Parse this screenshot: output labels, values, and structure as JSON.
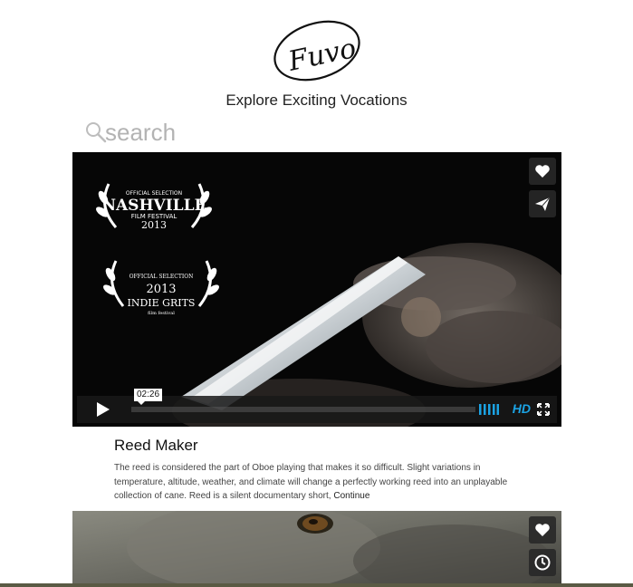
{
  "header": {
    "logo_text": "Fuvo",
    "tagline": "Explore Exciting Vocations"
  },
  "search": {
    "placeholder": "search"
  },
  "videos": [
    {
      "laurels": [
        {
          "line1": "OFFICIAL SELECTION",
          "line2": "NASHVILLE",
          "line3": "FILM FESTIVAL",
          "line4": "2013"
        },
        {
          "line1": "OFFICIAL SELECTION",
          "line2": "2013",
          "line3": "INDIE GRITS",
          "line4": "film festival"
        }
      ],
      "duration": "02:26",
      "quality": "HD",
      "title": "Reed Maker",
      "description": "The reed is considered the part of Oboe playing that makes it so difficult. Slight variations in temperature, altitude, weather, and climate will change a perfectly working reed into an unplayable collection of cane. Reed is a silent documentary short,",
      "continue_label": "Continue"
    }
  ],
  "colors": {
    "accent": "#1ba3e4",
    "video_bg": "#050505",
    "text": "#222222"
  }
}
